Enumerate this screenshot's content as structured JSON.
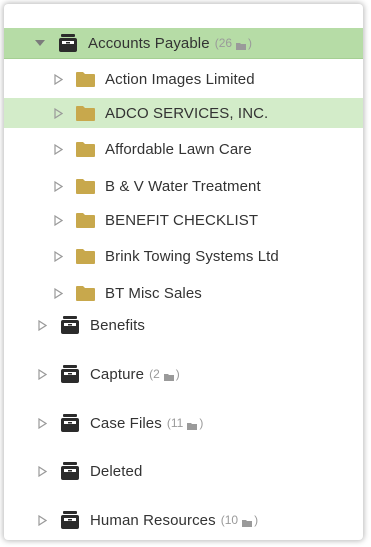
{
  "tree": {
    "root": {
      "label": "Accounts Payable",
      "count": "26",
      "count_open": "(",
      "count_close": ")"
    },
    "children": [
      {
        "label": "Action Images Limited"
      },
      {
        "label": "ADCO SERVICES, INC."
      },
      {
        "label": "Affordable Lawn Care"
      },
      {
        "label": "B & V Water Treatment"
      },
      {
        "label": "BENEFIT CHECKLIST"
      },
      {
        "label": "Brink Towing Systems Ltd"
      },
      {
        "label": "BT Misc Sales"
      }
    ],
    "cabinets": [
      {
        "label": "Benefits"
      },
      {
        "label": "Capture",
        "count": "2",
        "count_open": "(",
        "count_close": ")"
      },
      {
        "label": "Case Files",
        "count": "11",
        "count_open": "(",
        "count_close": ")"
      },
      {
        "label": "Deleted"
      },
      {
        "label": "Human Resources",
        "count": "10",
        "count_open": "(",
        "count_close": ")"
      }
    ]
  },
  "colors": {
    "root_highlight": "#b6dca6",
    "row_highlight": "#d3ecc9",
    "folder": "#c8a84c",
    "cabinet": "#2b2b2b",
    "count_text": "#9a9a9a"
  },
  "icons": {
    "root_toggle": "triangle-down-icon",
    "collapsed_toggle": "triangle-right-outline-icon",
    "cabinet": "cabinet-icon",
    "folder": "folder-icon"
  }
}
